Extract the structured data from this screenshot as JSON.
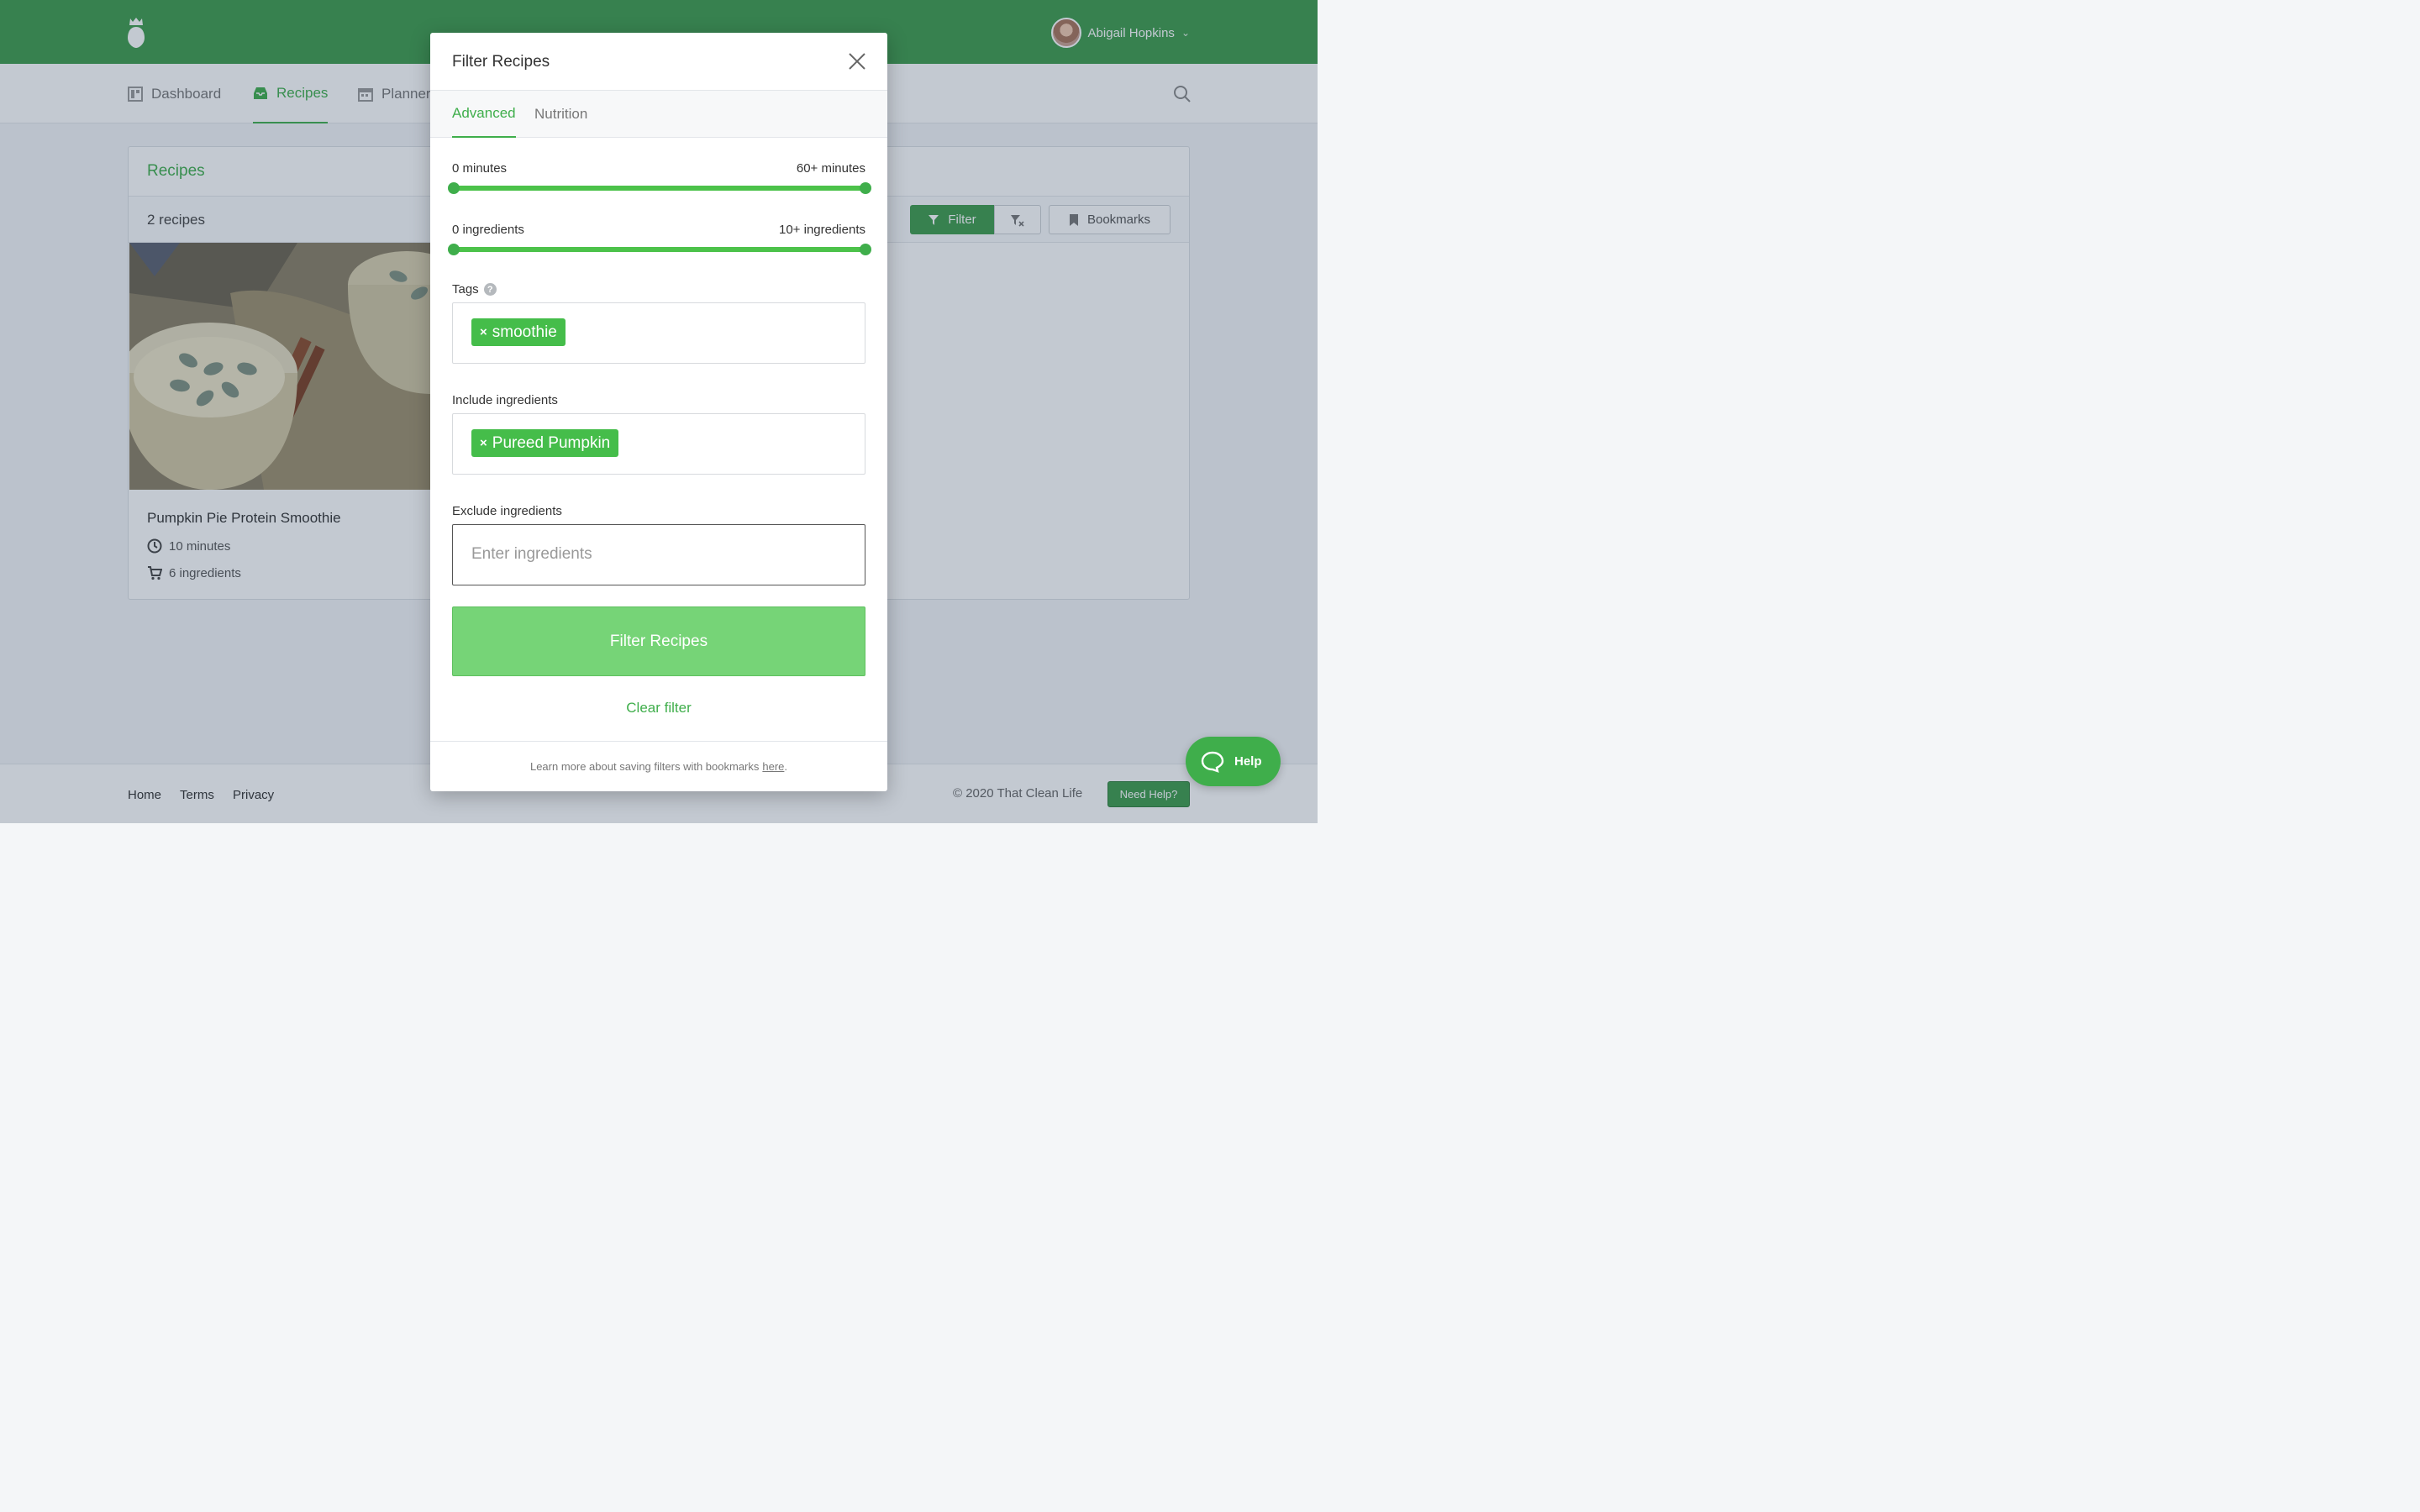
{
  "header": {
    "user_name": "Abigail Hopkins"
  },
  "nav": {
    "items": [
      {
        "label": "Dashboard"
      },
      {
        "label": "Recipes"
      },
      {
        "label": "Planner"
      }
    ]
  },
  "recipes_panel": {
    "title": "Recipes",
    "count": "2 recipes",
    "filter_label": "Filter",
    "bookmarks_label": "Bookmarks",
    "card": {
      "title": "Pumpkin Pie Protein Smoothie",
      "time": "10 minutes",
      "ingredients": "6 ingredients"
    }
  },
  "footer": {
    "links": [
      "Home",
      "Terms",
      "Privacy"
    ],
    "copyright": "© 2020 That Clean Life",
    "need_help": "Need Help?"
  },
  "modal": {
    "title": "Filter Recipes",
    "tabs": [
      "Advanced",
      "Nutrition"
    ],
    "time_range": {
      "min_label": "0 minutes",
      "max_label": "60+ minutes",
      "min": 0,
      "max": 60
    },
    "ingredient_range": {
      "min_label": "0 ingredients",
      "max_label": "10+ ingredients",
      "min": 0,
      "max": 10
    },
    "tags_label": "Tags",
    "tags": [
      "smoothie"
    ],
    "include_label": "Include ingredients",
    "include": [
      "Pureed Pumpkin"
    ],
    "exclude_label": "Exclude ingredients",
    "exclude_placeholder": "Enter ingredients",
    "submit_label": "Filter Recipes",
    "clear_label": "Clear filter",
    "footer_text": "Learn more about saving filters with bookmarks",
    "footer_link": "here",
    "footer_end": "."
  },
  "help_bubble": "Help",
  "colors": {
    "brand": "#3d9b4c",
    "accent": "#3fae4b"
  }
}
